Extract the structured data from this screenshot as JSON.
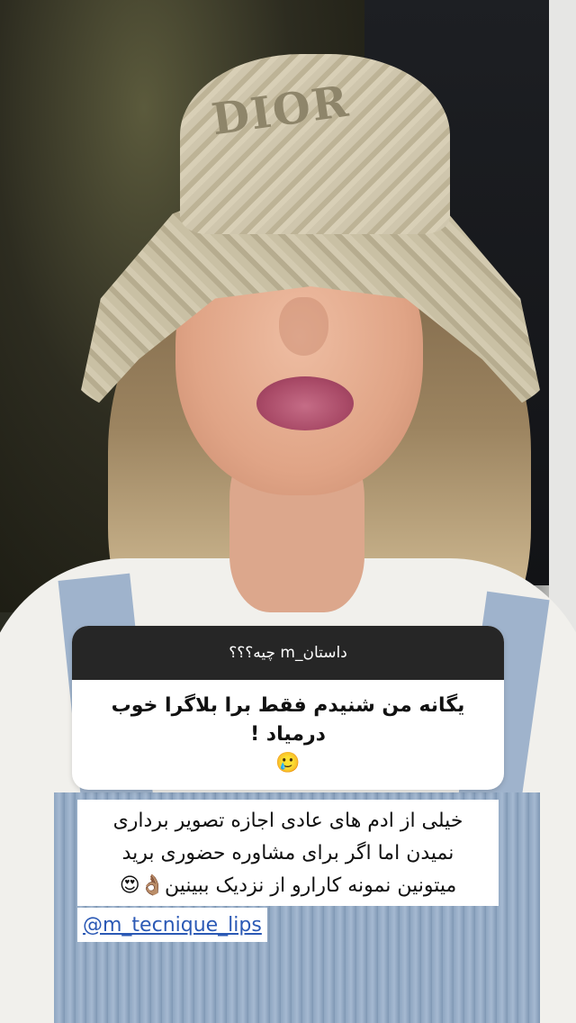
{
  "story": {
    "question_sticker": {
      "header": "داستان_m چیه؟؟؟",
      "answer": "یگانه من شنیدم فقط برا بلاگرا خوب درمیاد !",
      "answer_emoji": "🥲"
    },
    "caption": {
      "line1": "خیلی از ادم های عادی اجازه تصویر برداری",
      "line2": "نمیدن اما اگر برای مشاوره حضوری برید",
      "line3": "میتونین نمونه کارارو از نزدیک ببینین👌🏽😍"
    },
    "mention": "@m_tecnique_lips",
    "hat_logo": "DIOR"
  },
  "colors": {
    "sticker_header_bg": "#262626",
    "mention_color": "#2b59b5"
  }
}
